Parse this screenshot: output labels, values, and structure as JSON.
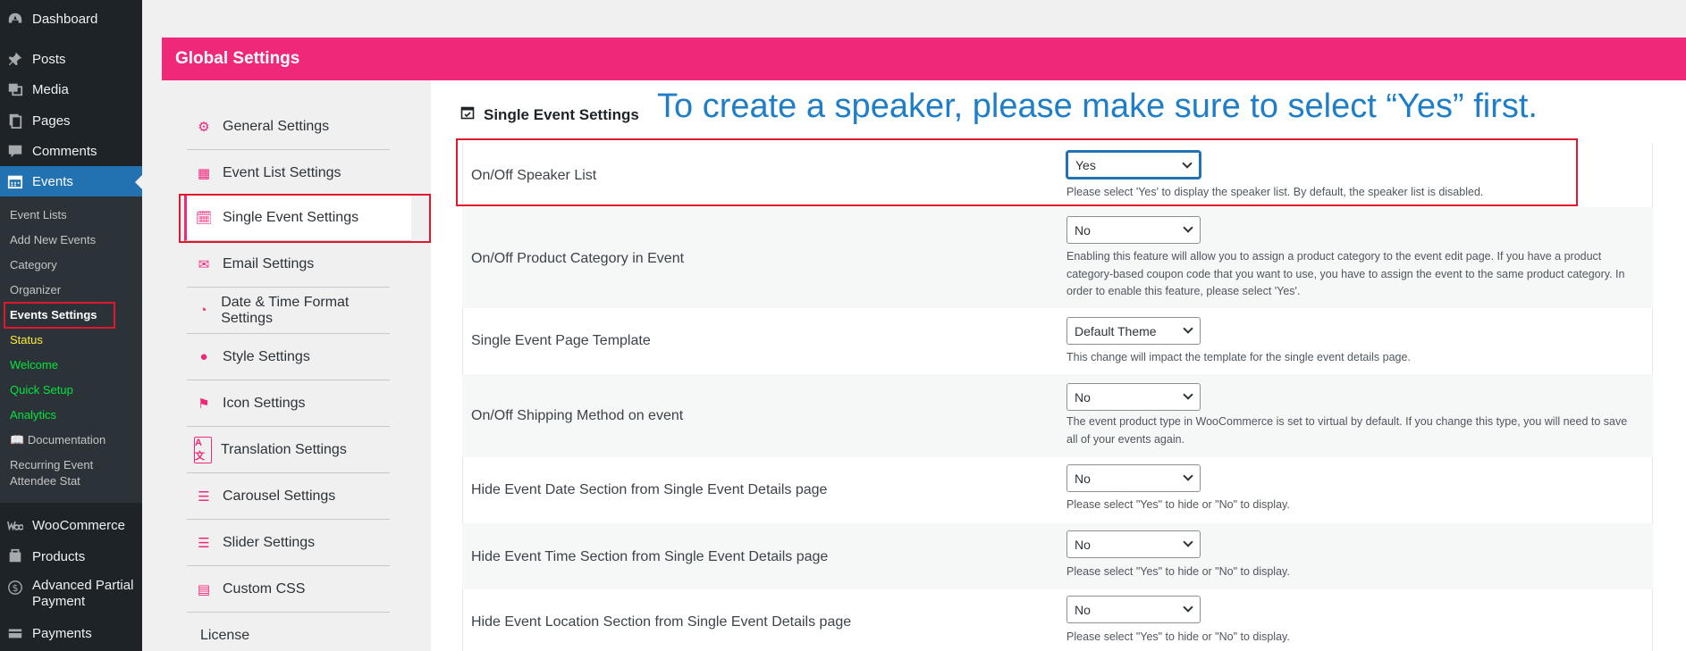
{
  "admin_menu": {
    "top_items": [
      {
        "label": "Dashboard",
        "icon": "dashboard-icon"
      },
      {
        "label": "Posts",
        "icon": "pin-icon"
      },
      {
        "label": "Media",
        "icon": "media-icon"
      },
      {
        "label": "Pages",
        "icon": "pages-icon"
      },
      {
        "label": "Comments",
        "icon": "comment-icon"
      },
      {
        "label": "Events",
        "icon": "calendar-icon"
      }
    ],
    "sub_items": [
      "Event Lists",
      "Add New Events",
      "Category",
      "Organizer",
      "Events Settings",
      "Status",
      "Welcome",
      "Quick Setup",
      "Analytics",
      "Documentation",
      "Recurring Event",
      "Attendee Stat"
    ],
    "bottom_items": [
      {
        "label": "WooCommerce",
        "icon": "woo-icon"
      },
      {
        "label": "Products",
        "icon": "products-icon"
      },
      {
        "label": "Advanced Partial",
        "label2": "Payment",
        "icon": "dollar-icon"
      },
      {
        "label": "Payments",
        "icon": "payments-icon"
      }
    ]
  },
  "header": {
    "title": "Global Settings"
  },
  "nav": [
    {
      "label": "General Settings",
      "icon": "gears-icon"
    },
    {
      "label": "Event List Settings",
      "icon": "calendar-grid-icon"
    },
    {
      "label": "Single Event Settings",
      "icon": "calendar-check-icon"
    },
    {
      "label": "Email Settings",
      "icon": "envelope-icon"
    },
    {
      "label": "Date & Time Format Settings",
      "icon": "clock-icon"
    },
    {
      "label": "Style Settings",
      "icon": "palette-icon"
    },
    {
      "label": "Icon Settings",
      "icon": "flag-icon"
    },
    {
      "label": "Translation Settings",
      "icon": "language-icon"
    },
    {
      "label": "Carousel Settings",
      "icon": "sliders-icon"
    },
    {
      "label": "Slider Settings",
      "icon": "sliders-icon"
    },
    {
      "label": "Custom CSS",
      "icon": "css-file-icon"
    },
    {
      "label": "License",
      "icon": ""
    }
  ],
  "section": {
    "title": "Single Event Settings"
  },
  "annotation": "To create a speaker, please make sure to select “Yes” first.",
  "settings": [
    {
      "label": "On/Off Speaker List",
      "value": "Yes",
      "desc": "Please select 'Yes' to display the speaker list. By default, the speaker list is disabled."
    },
    {
      "label": "On/Off Product Category in Event",
      "value": "No",
      "desc": "Enabling this feature will allow you to assign a product category to the event edit page. If you have a product category-based coupon code that you want to use, you have to assign the event to the same product category. In order to enable this feature, please select 'Yes'."
    },
    {
      "label": "Single Event Page Template",
      "value": "Default Theme",
      "desc": "This change will impact the template for the single event details page."
    },
    {
      "label": "On/Off Shipping Method on event",
      "value": "No",
      "desc": "The event product type in WooCommerce is set to virtual by default. If you change this type, you will need to save all of your events again."
    },
    {
      "label": "Hide Event Date Section from Single Event Details page",
      "value": "No",
      "desc": "Please select \"Yes\" to hide or \"No\" to display."
    },
    {
      "label": "Hide Event Time Section from Single Event Details page",
      "value": "No",
      "desc": "Please select \"Yes\" to hide or \"No\" to display."
    },
    {
      "label": "Hide Event Location Section from Single Event Details page",
      "value": "No",
      "desc": "Please select \"Yes\" to hide or \"No\" to display."
    }
  ],
  "colors": {
    "accent": "#f0287a",
    "wp_blue": "#2271b1",
    "highlight_red": "#e0182d",
    "annotation_blue": "#1e7ec8"
  }
}
